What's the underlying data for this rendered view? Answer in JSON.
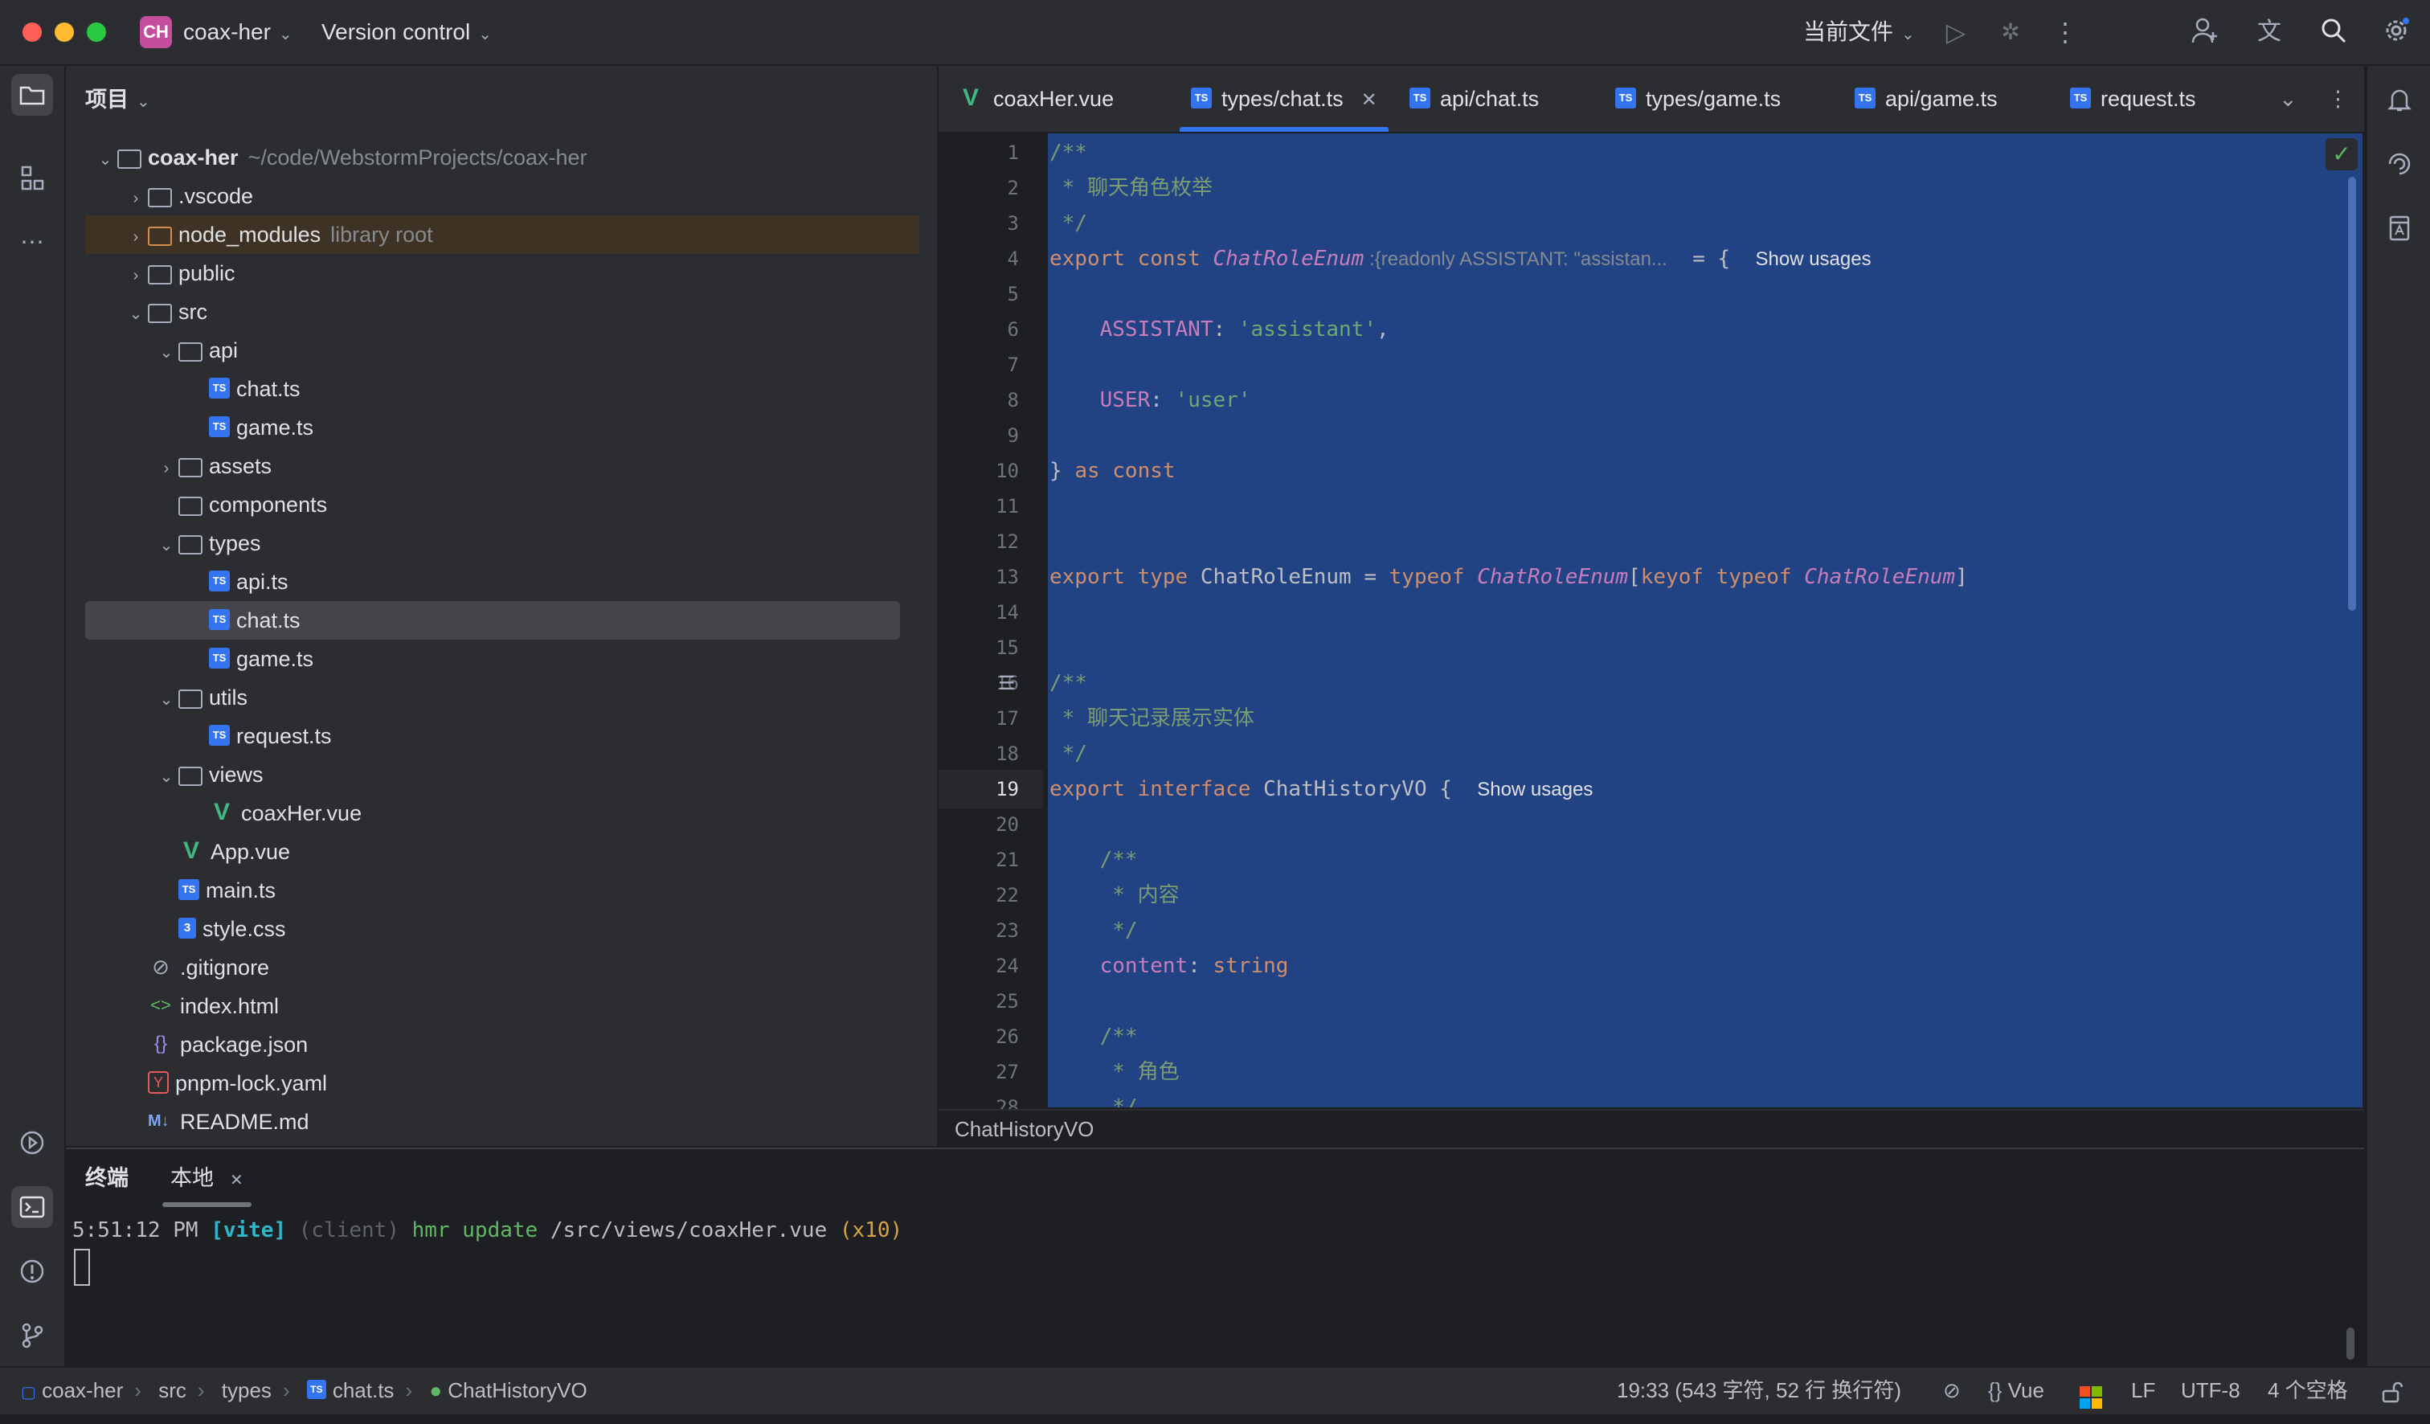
{
  "titlebar": {
    "project_badge": "CH",
    "project_name": "coax-her",
    "vcs": "Version control",
    "run_config": "当前文件"
  },
  "project_panel": {
    "title": "项目",
    "items": [
      {
        "name": "coax-her",
        "hint": "~/code/WebstormProjects/coax-her"
      },
      {
        "name": ".vscode"
      },
      {
        "name": "node_modules",
        "hint": "library root"
      },
      {
        "name": "public"
      },
      {
        "name": "src"
      },
      {
        "name": "api"
      },
      {
        "name": "chat.ts"
      },
      {
        "name": "game.ts"
      },
      {
        "name": "assets"
      },
      {
        "name": "components"
      },
      {
        "name": "types"
      },
      {
        "name": "api.ts"
      },
      {
        "name": "chat.ts"
      },
      {
        "name": "game.ts"
      },
      {
        "name": "utils"
      },
      {
        "name": "request.ts"
      },
      {
        "name": "views"
      },
      {
        "name": "coaxHer.vue"
      },
      {
        "name": "App.vue"
      },
      {
        "name": "main.ts"
      },
      {
        "name": "style.css"
      },
      {
        "name": ".gitignore"
      },
      {
        "name": "index.html"
      },
      {
        "name": "package.json"
      },
      {
        "name": "pnpm-lock.yaml"
      },
      {
        "name": "README.md"
      }
    ]
  },
  "editor_tabs": [
    {
      "label": "coaxHer.vue"
    },
    {
      "label": "types/chat.ts"
    },
    {
      "label": "api/chat.ts"
    },
    {
      "label": "types/game.ts"
    },
    {
      "label": "api/game.ts"
    },
    {
      "label": "request.ts"
    }
  ],
  "editor": {
    "current_line": "19",
    "line_numbers": [
      "1",
      "2",
      "3",
      "4",
      "5",
      "6",
      "7",
      "8",
      "9",
      "10",
      "11",
      "12",
      "13",
      "14",
      "15",
      "16",
      "17",
      "18",
      "19",
      "20",
      "21",
      "22",
      "23",
      "24",
      "25",
      "26",
      "27",
      "28"
    ],
    "code": {
      "l1": "/**",
      "l2": " * 聊天角色枚举",
      "l3": " */",
      "l4_kw": "export const ",
      "l4_name": "ChatRoleEnum",
      "l4_hint": " :{readonly ASSISTANT: \"assistan...",
      "l4_rest": "  = {  ",
      "l6_key": "    ASSISTANT",
      "l6_colon": ": ",
      "l6_val": "'assistant'",
      "l6_end": ",",
      "l8_key": "    USER",
      "l8_colon": ": ",
      "l8_val": "'user'",
      "l10_brace": "} ",
      "l10_kw": "as const",
      "l13_kw": "export type ",
      "l13_name": "ChatRoleEnum = ",
      "l13_typeof": "typeof ",
      "l13_ref": "ChatRoleEnum",
      "l13_b": "[",
      "l13_kw2": "keyof typeof ",
      "l13_ref2": "ChatRoleEnum",
      "l13_end": "]",
      "l16": "/**",
      "l17": " * 聊天记录展示实体",
      "l18": " */",
      "l19_kw": "export interface ",
      "l19_name": "ChatHistoryVO {  ",
      "l21": "    /**",
      "l22": "     * 内容",
      "l23": "     */",
      "l24_key": "    content",
      "l24_colon": ": ",
      "l24_type": "string",
      "l26": "    /**",
      "l27": "     * 角色",
      "l28": "     */"
    },
    "show_usages": "Show usages",
    "breadcrumb": "ChatHistoryVO"
  },
  "terminal": {
    "tab_title": "终端",
    "tab_local": "本地",
    "time": "5:51:12 PM ",
    "vite": "[vite]",
    "client": " (client) ",
    "hmr": "hmr update ",
    "path": "/src/views/coaxHer.vue ",
    "count": "(x10)"
  },
  "statusbar": {
    "crumbs": [
      "coax-her",
      "src",
      "types",
      "chat.ts",
      "ChatHistoryVO"
    ],
    "position": "19:33 (543 字符, 52 行 换行符)",
    "language": "Vue",
    "line_sep": "LF",
    "encoding": "UTF-8",
    "indent": "4 个空格"
  },
  "colors": {
    "accent": "#3574f0",
    "selection": "#214283",
    "background": "#1e1f22",
    "panel": "#2b2d30"
  }
}
